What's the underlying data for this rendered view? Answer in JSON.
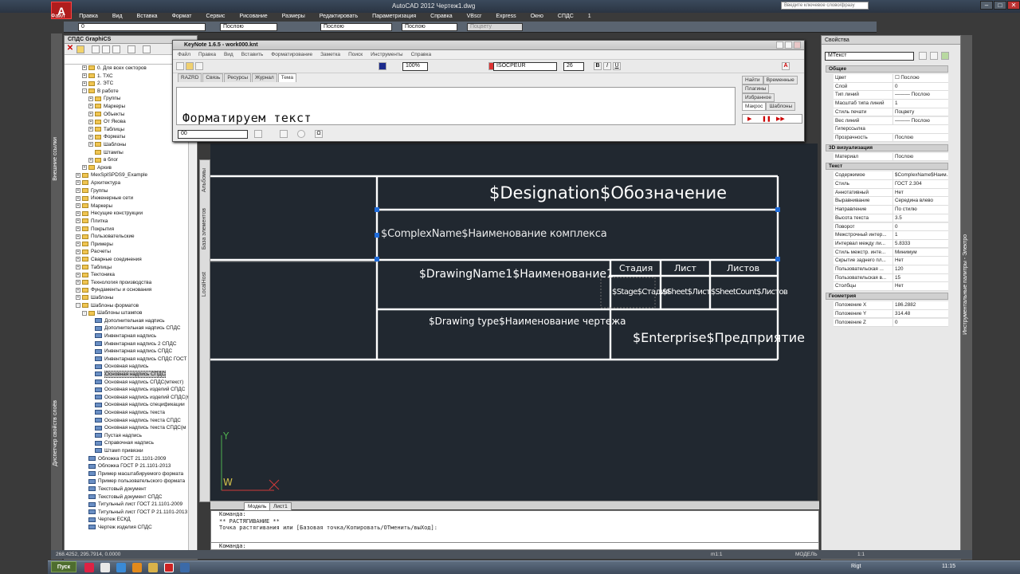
{
  "app": {
    "title": "AutoCAD 2012   Чертеж1.dwg",
    "logo": "A",
    "search_placeholder": "Введите ключевое слово/фразу"
  },
  "menu": [
    "Файл",
    "Правка",
    "Вид",
    "Вставка",
    "Формат",
    "Сервис",
    "Рисование",
    "Размеры",
    "Редактировать",
    "Параметризация",
    "Справка",
    "VBscr",
    "Express",
    "Окно",
    "СПДС",
    "1"
  ],
  "toolbar2": {
    "layer": "0",
    "combo1": "Послою",
    "combo2": "Послою",
    "combo3": "Послою",
    "combo4": "Поцвету"
  },
  "left_strip": {
    "label_top": "Внешние ссылки",
    "label_bottom": "Диспетчер свойств слоёв"
  },
  "spds_panel": {
    "title": "СПДС GraphiCS",
    "tree": [
      {
        "label": "0. Для всех секторов",
        "level": 2,
        "exp": "+",
        "icon": "folder"
      },
      {
        "label": "1. ТХС",
        "level": 2,
        "exp": "+",
        "icon": "folder"
      },
      {
        "label": "2. ЭТС",
        "level": 2,
        "exp": "+",
        "icon": "folder"
      },
      {
        "label": "В работе",
        "level": 2,
        "exp": "-",
        "icon": "folder"
      },
      {
        "label": "Группы",
        "level": 3,
        "exp": "+",
        "icon": "folder"
      },
      {
        "label": "Маркеры",
        "level": 3,
        "exp": "+",
        "icon": "folder"
      },
      {
        "label": "Объекты",
        "level": 3,
        "exp": "+",
        "icon": "folder"
      },
      {
        "label": "От Яковa",
        "level": 3,
        "exp": "+",
        "icon": "folder"
      },
      {
        "label": "Таблицы",
        "level": 3,
        "exp": "+",
        "icon": "folder"
      },
      {
        "label": "Форматы",
        "level": 3,
        "exp": "+",
        "icon": "folder"
      },
      {
        "label": "Шаблоны",
        "level": 3,
        "exp": "+",
        "icon": "folder"
      },
      {
        "label": "Штампы",
        "level": 3,
        "exp": "",
        "icon": "folder"
      },
      {
        "label": "в блог",
        "level": 3,
        "exp": "+",
        "icon": "folder"
      },
      {
        "label": "Архив",
        "level": 2,
        "exp": "+",
        "icon": "folder"
      },
      {
        "label": "MexSpISPDS9_Example",
        "level": 1,
        "exp": "+",
        "icon": "folder"
      },
      {
        "label": "Архитектура",
        "level": 1,
        "exp": "+",
        "icon": "folder"
      },
      {
        "label": "Группы",
        "level": 1,
        "exp": "+",
        "icon": "folder"
      },
      {
        "label": "Инженерные сети",
        "level": 1,
        "exp": "+",
        "icon": "folder"
      },
      {
        "label": "Маркеры",
        "level": 1,
        "exp": "+",
        "icon": "folder"
      },
      {
        "label": "Несущие конструкции",
        "level": 1,
        "exp": "+",
        "icon": "folder"
      },
      {
        "label": "Плитка",
        "level": 1,
        "exp": "+",
        "icon": "folder"
      },
      {
        "label": "Покрытия",
        "level": 1,
        "exp": "+",
        "icon": "folder"
      },
      {
        "label": "Пользовательские",
        "level": 1,
        "exp": "+",
        "icon": "folder"
      },
      {
        "label": "Примеры",
        "level": 1,
        "exp": "+",
        "icon": "folder"
      },
      {
        "label": "Расчеты",
        "level": 1,
        "exp": "+",
        "icon": "folder"
      },
      {
        "label": "Сварные соединения",
        "level": 1,
        "exp": "+",
        "icon": "folder"
      },
      {
        "label": "Таблицы",
        "level": 1,
        "exp": "+",
        "icon": "folder"
      },
      {
        "label": "Тектоника",
        "level": 1,
        "exp": "+",
        "icon": "folder"
      },
      {
        "label": "Технология производства",
        "level": 1,
        "exp": "+",
        "icon": "folder"
      },
      {
        "label": "Фундаменты и основания",
        "level": 1,
        "exp": "+",
        "icon": "folder"
      },
      {
        "label": "Шаблоны",
        "level": 1,
        "exp": "+",
        "icon": "folder"
      },
      {
        "label": "Шаблоны форматов",
        "level": 1,
        "exp": "-",
        "icon": "folder"
      },
      {
        "label": "Шаблоны штампов",
        "level": 2,
        "exp": "-",
        "icon": "folder"
      },
      {
        "label": "Дополнительная надпись",
        "level": 3,
        "exp": "",
        "icon": "doc"
      },
      {
        "label": "Дополнительная надпись СПДС",
        "level": 3,
        "exp": "",
        "icon": "doc"
      },
      {
        "label": "Инвентарная надпись",
        "level": 3,
        "exp": "",
        "icon": "doc"
      },
      {
        "label": "Инвентарная надпись 2 СПДС",
        "level": 3,
        "exp": "",
        "icon": "doc"
      },
      {
        "label": "Инвентарная надпись СПДС",
        "level": 3,
        "exp": "",
        "icon": "doc"
      },
      {
        "label": "Инвентарная надпись СПДС ГОСТ Р",
        "level": 3,
        "exp": "",
        "icon": "doc"
      },
      {
        "label": "Основная надпись",
        "level": 3,
        "exp": "",
        "icon": "doc"
      },
      {
        "label": "Основная надпись СПДС",
        "level": 3,
        "exp": "",
        "icon": "doc",
        "selected": true
      },
      {
        "label": "Основная надпись СПДС(мтекст)",
        "level": 3,
        "exp": "",
        "icon": "doc"
      },
      {
        "label": "Основная надпись изделий СПДС",
        "level": 3,
        "exp": "",
        "icon": "doc"
      },
      {
        "label": "Основная надпись изделий СПДС(м",
        "level": 3,
        "exp": "",
        "icon": "doc"
      },
      {
        "label": "Основная надпись спецификации",
        "level": 3,
        "exp": "",
        "icon": "doc"
      },
      {
        "label": "Основная надпись текста",
        "level": 3,
        "exp": "",
        "icon": "doc"
      },
      {
        "label": "Основная надпись текста СПДС",
        "level": 3,
        "exp": "",
        "icon": "doc"
      },
      {
        "label": "Основная надпись текста СПДС(м",
        "level": 3,
        "exp": "",
        "icon": "doc"
      },
      {
        "label": "Пустая надпись",
        "level": 3,
        "exp": "",
        "icon": "doc"
      },
      {
        "label": "Справочная надпись",
        "level": 3,
        "exp": "",
        "icon": "doc"
      },
      {
        "label": "Штамп привязки",
        "level": 3,
        "exp": "",
        "icon": "doc"
      },
      {
        "label": "Обложка ГОСТ 21.1101-2009",
        "level": 2,
        "exp": "",
        "icon": "doc"
      },
      {
        "label": "Обложка ГОСТ Р 21.1101-2013",
        "level": 2,
        "exp": "",
        "icon": "doc"
      },
      {
        "label": "Пример масштабируемого формата",
        "level": 2,
        "exp": "",
        "icon": "doc"
      },
      {
        "label": "Пример пользовательского формата",
        "level": 2,
        "exp": "",
        "icon": "doc"
      },
      {
        "label": "Текстовый документ",
        "level": 2,
        "exp": "",
        "icon": "doc"
      },
      {
        "label": "Текстовый документ СПДС",
        "level": 2,
        "exp": "",
        "icon": "doc"
      },
      {
        "label": "Титульный лист ГОСТ 21.1101-2009",
        "level": 2,
        "exp": "",
        "icon": "doc"
      },
      {
        "label": "Титульный лист ГОСТ Р 21.1101-2013",
        "level": 2,
        "exp": "",
        "icon": "doc"
      },
      {
        "label": "Чертеж ЕСКД",
        "level": 2,
        "exp": "",
        "icon": "doc"
      },
      {
        "label": "Чертеж изделия СПДС",
        "level": 2,
        "exp": "",
        "icon": "doc"
      }
    ]
  },
  "side_tabs": [
    "Альбомы",
    "База элементов",
    "LocalHost"
  ],
  "keynote": {
    "title": "KeyNote 1.6.5 - work000.knt",
    "menu": [
      "Файл",
      "Правка",
      "Вид",
      "Вставить",
      "Форматирование",
      "Заметка",
      "Поиск",
      "Инструменты",
      "Справка"
    ],
    "zoom": "100%",
    "font": "ISOCPEUR",
    "size": "26",
    "tabs": [
      "RAZRD",
      "Связь",
      "Ресурсы",
      "Журнал",
      "Тема"
    ],
    "editor_text": "Форматируем текст",
    "right_tabs_top": [
      "Найти",
      "Временные"
    ],
    "right_tabs_mid": [
      "Плагины"
    ],
    "right_tabs_mid2": [
      "Избранное"
    ],
    "right_tabs_bottom": [
      "Макрос",
      "Шаблоны"
    ],
    "style_combo": "00"
  },
  "drawing": {
    "designation": "$Designation$Обозначение",
    "complex": "$ComplexName$Наименование комплекса",
    "drawing_name": "$DrawingName1$Наименование1",
    "drawing_type": "$Drawing type$Наименование чертежа",
    "stage_h": "Стадия",
    "sheet_h": "Лист",
    "sheets_h": "Листов",
    "stage": "$Stage$Стадия",
    "sheet": "$Sheet$Лист",
    "sheet_count": "$SheetCount$Листов",
    "enterprise": "$Enterprise$Предприятие",
    "ucs_y": "Y",
    "ucs_w": "W"
  },
  "layout_tabs": [
    "Модель",
    "Лист1"
  ],
  "command": {
    "lines": [
      "Команда:",
      "** РАСТЯГИВАНИЕ **",
      "Точка растягивания или [Базовая точка/Копировать/ОТменить/выХод]:"
    ],
    "prompt": "Команда:"
  },
  "properties": {
    "title": "Свойства",
    "selected": "МТекст",
    "sections": [
      {
        "name": "Общие",
        "rows": [
          [
            "Цвет",
            "☐ Послою"
          ],
          [
            "Слой",
            "0"
          ],
          [
            "Тип линий",
            "——— Послою"
          ],
          [
            "Масштаб типа линий",
            "1"
          ],
          [
            "Стиль печати",
            "Поцвету"
          ],
          [
            "Вес линий",
            "——— Послою"
          ],
          [
            "Гиперссылка",
            ""
          ],
          [
            "Прозрачность",
            "Послою"
          ]
        ]
      },
      {
        "name": "3D визуализация",
        "rows": [
          [
            "Материал",
            "Послою"
          ]
        ]
      },
      {
        "name": "Текст",
        "rows": [
          [
            "Содержимое",
            "$ComplexName$Наим..."
          ],
          [
            "Стиль",
            "ГОСТ 2.304"
          ],
          [
            "Аннотативный",
            "Нет"
          ],
          [
            "Выравнивание",
            "Середина влево"
          ],
          [
            "Направление",
            "По стилю"
          ],
          [
            "Высота текста",
            "3.5"
          ],
          [
            "Поворот",
            "0"
          ],
          [
            "Межстрочный интер...",
            "1"
          ],
          [
            "Интервал между ли...",
            "5.8333"
          ],
          [
            "Стиль межстр. инте...",
            "Минимум"
          ],
          [
            "Скрытие заднего пл...",
            "Нет"
          ],
          [
            "Пользовательская ...",
            "120"
          ],
          [
            "Пользовательская в...",
            "15"
          ],
          [
            "Столбцы",
            "Нет"
          ]
        ]
      },
      {
        "name": "Геометрия",
        "rows": [
          [
            "Положение X",
            "186.2882"
          ],
          [
            "Положение Y",
            "314.48"
          ],
          [
            "Положение Z",
            "0"
          ]
        ]
      }
    ]
  },
  "right_strip": "Инструментальные палитры - Электро",
  "status": {
    "coords": "268.4252, 295.7914, 0.0000",
    "scale": "m1:1",
    "model": "МОДЕЛЬ",
    "annot": "1:1"
  },
  "taskbar": {
    "start": "Пуск",
    "lang": "Rigt",
    "time": "11:15"
  }
}
